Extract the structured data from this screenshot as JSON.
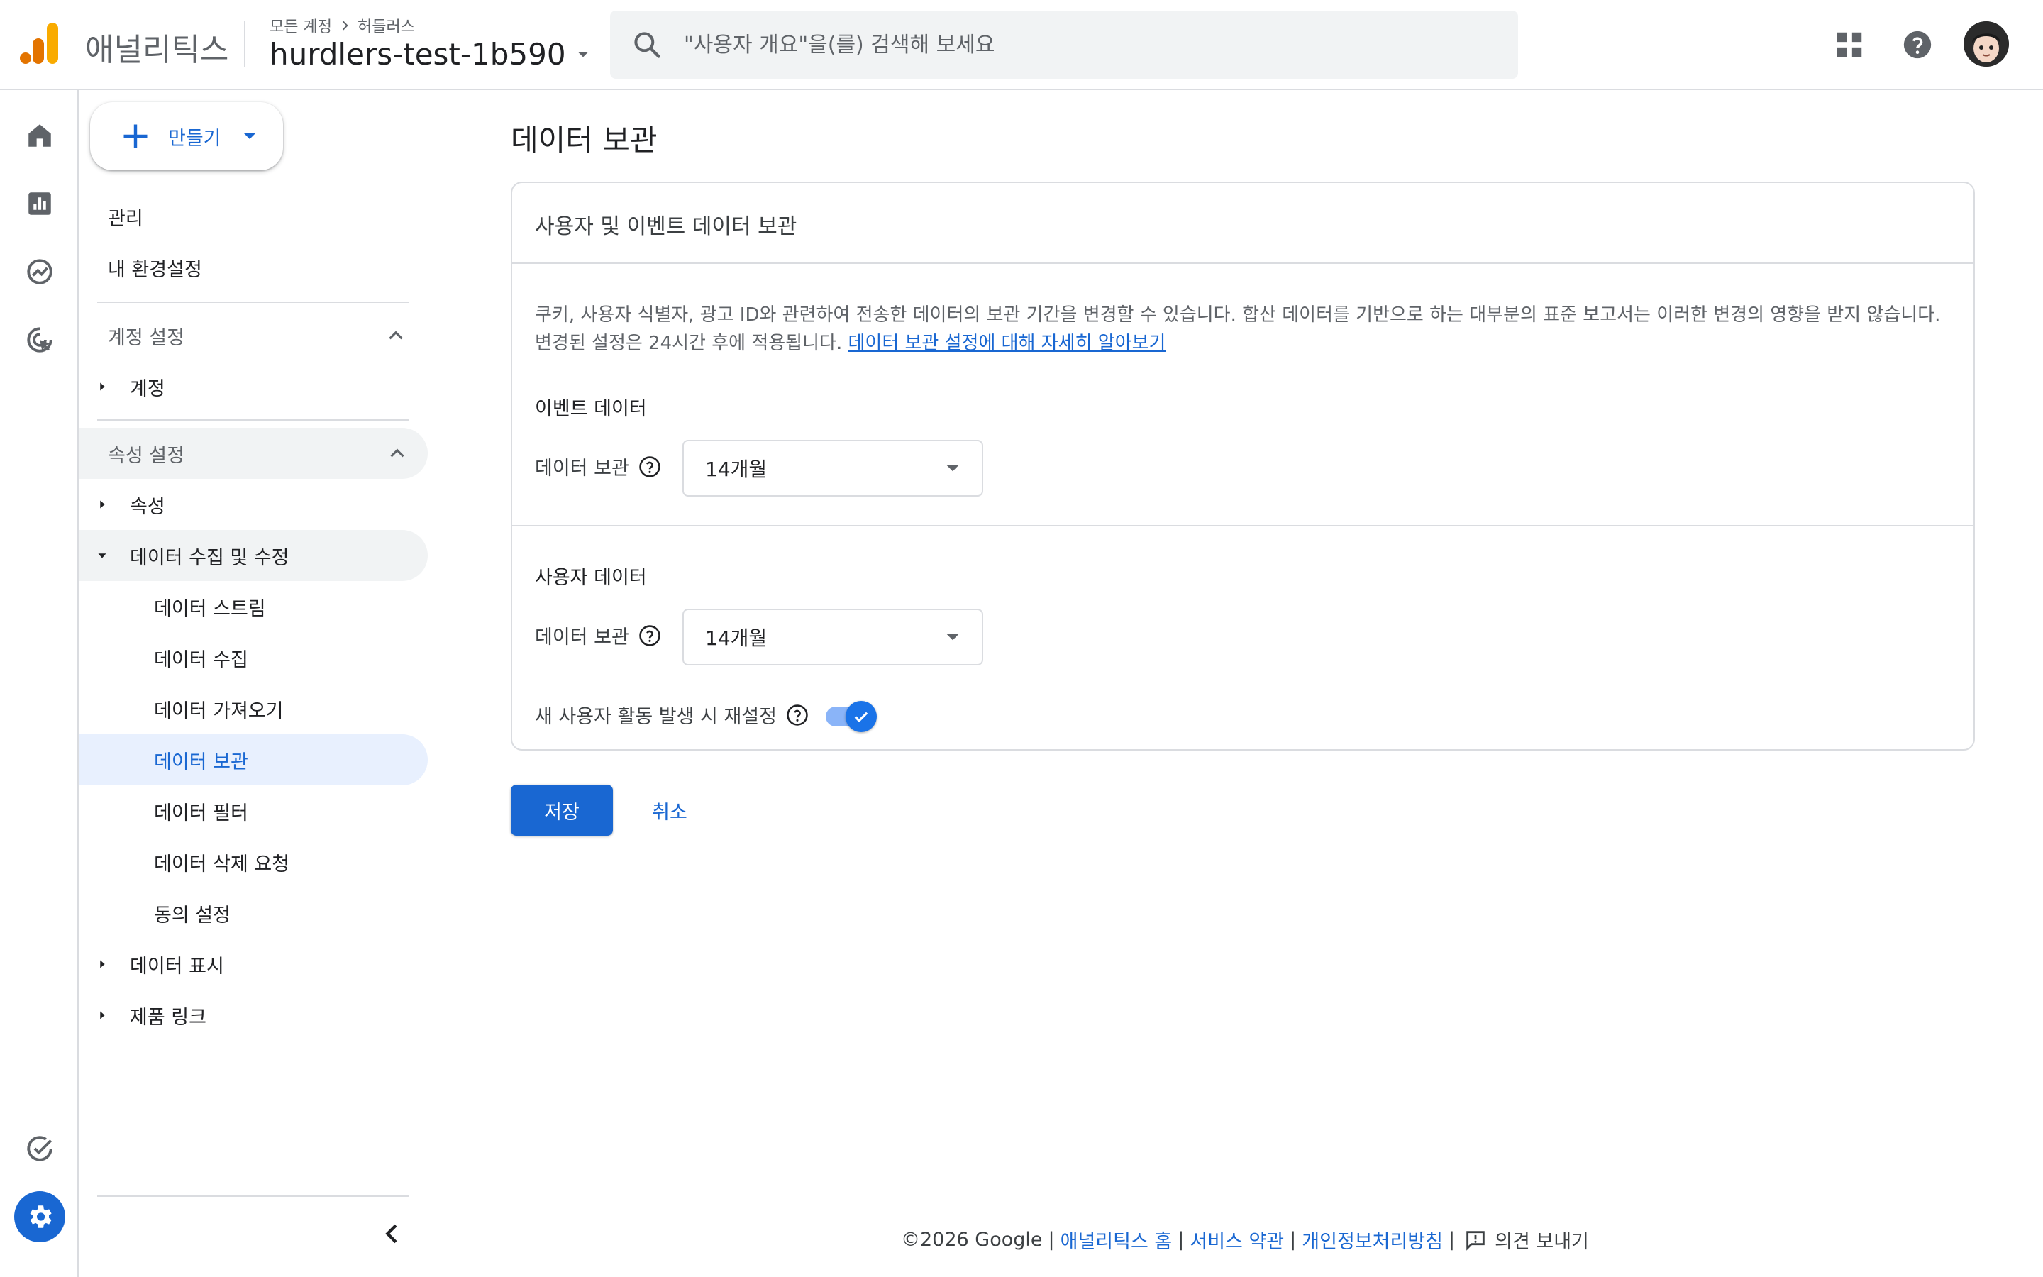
{
  "header": {
    "product_name": "애널리틱스",
    "breadcrumb_root": "모든 계정",
    "breadcrumb_account": "허들러스",
    "property_name": "hurdlers-test-1b590",
    "search_placeholder": "\"사용자 개요\"을(를) 검색해 보세요"
  },
  "icons": {
    "logo": "analytics-logo-icon",
    "apps": "apps-grid-icon",
    "help": "help-icon",
    "avatar": "user-avatar"
  },
  "rail": [
    "home-icon",
    "reports-icon",
    "explore-icon",
    "advertising-icon",
    "insights-check-icon",
    "admin-gear-icon"
  ],
  "nav": {
    "create_label": "만들기",
    "admin": "관리",
    "my_preferences": "내 환경설정",
    "account_settings": "계정 설정",
    "account": "계정",
    "property_settings": "속성 설정",
    "property": "속성",
    "data_collection": "데이터 수집 및 수정",
    "data_streams": "데이터 스트림",
    "data_collect": "데이터 수집",
    "data_import": "데이터 가져오기",
    "data_retention": "데이터 보관",
    "data_filters": "데이터 필터",
    "data_deletion": "데이터 삭제 요청",
    "consent_settings": "동의 설정",
    "data_display": "데이터 표시",
    "product_links": "제품 링크"
  },
  "main": {
    "page_title": "데이터 보관",
    "card_title": "사용자 및 이벤트 데이터 보관",
    "description": "쿠키, 사용자 식별자, 광고 ID와 관련하여 전송한 데이터의 보관 기간을 변경할 수 있습니다. 합산 데이터를 기반으로 하는 대부분의 표준 보고서는 이러한 변경의 영향을 받지 않습니다. 변경된 설정은 24시간 후에 적용됩니다.",
    "learn_more_link": "데이터 보관 설정에 대해 자세히 알아보기",
    "event_data_heading": "이벤트 데이터",
    "event_retention_label": "데이터 보관",
    "event_retention_value": "14개월",
    "user_data_heading": "사용자 데이터",
    "user_retention_label": "데이터 보관",
    "user_retention_value": "14개월",
    "reset_label": "새 사용자 활동 발생 시 재설정",
    "reset_enabled": true,
    "save_label": "저장",
    "cancel_label": "취소"
  },
  "footer": {
    "copyright": "©2026 Google",
    "analytics_home": "애널리틱스 홈",
    "terms": "서비스 약관",
    "privacy": "개인정보처리방침",
    "feedback": "의견 보내기"
  },
  "colors": {
    "accent": "#1967d2",
    "selected_bg": "#e8f0fe",
    "logo_orange": "#f9ab00",
    "logo_dark_orange": "#e37400"
  }
}
